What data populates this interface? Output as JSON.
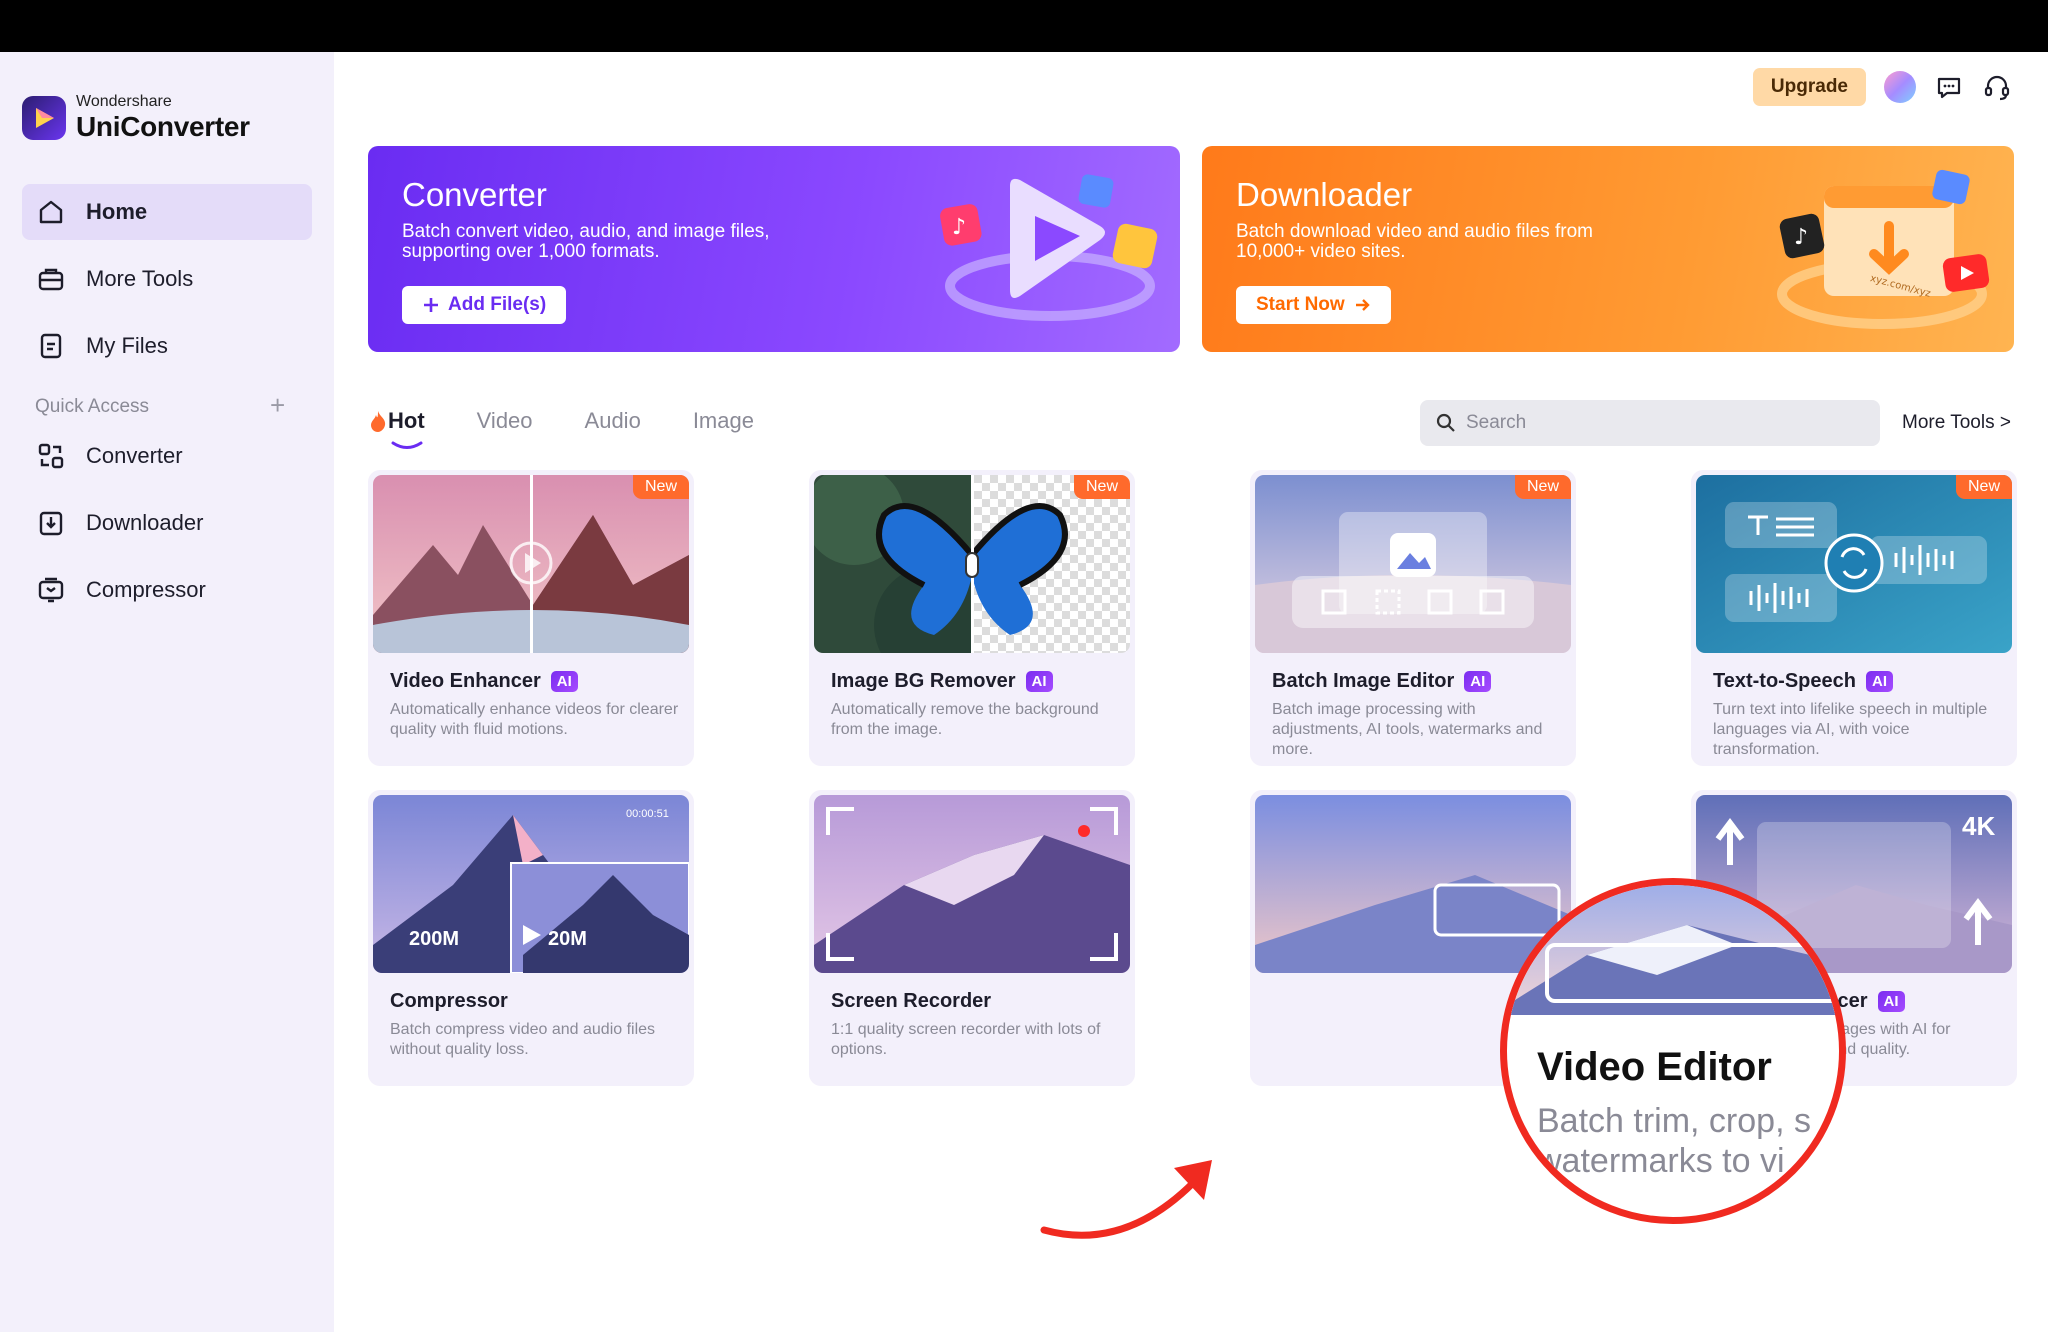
{
  "brand": {
    "small": "Wondershare",
    "big": "UniConverter"
  },
  "sidebar": {
    "items": [
      {
        "label": "Home"
      },
      {
        "label": "More Tools"
      },
      {
        "label": "My Files"
      }
    ],
    "quick_access_label": "Quick Access",
    "quick_access_plus": "+",
    "quick_items": [
      {
        "label": "Converter"
      },
      {
        "label": "Downloader"
      },
      {
        "label": "Compressor"
      }
    ]
  },
  "header": {
    "upgrade_label": "Upgrade"
  },
  "banners": {
    "converter": {
      "title": "Converter",
      "desc": "Batch convert video, audio, and image files, supporting over 1,000 formats.",
      "button": "Add File(s)"
    },
    "downloader": {
      "title": "Downloader",
      "desc": "Batch download video and audio files from 10,000+ video sites.",
      "button": "Start Now",
      "art_text": "xyz.com/xyz"
    }
  },
  "tabs": [
    {
      "label": "Hot"
    },
    {
      "label": "Video"
    },
    {
      "label": "Audio"
    },
    {
      "label": "Image"
    }
  ],
  "search": {
    "placeholder": "Search"
  },
  "more_tools_link": "More Tools >",
  "cards": [
    {
      "title": "Video Enhancer",
      "ai": "AI",
      "new": "New",
      "desc": "Automatically enhance videos for clearer quality with fluid motions."
    },
    {
      "title": "Image BG Remover",
      "ai": "AI",
      "new": "New",
      "desc": "Automatically remove the background from the image."
    },
    {
      "title": "Batch Image Editor",
      "ai": "AI",
      "new": "New",
      "desc": "Batch image processing with adjustments, AI tools, watermarks and more."
    },
    {
      "title": "Text-to-Speech",
      "ai": "AI",
      "new": "New",
      "desc": "Turn text into lifelike speech in multiple languages via AI, with voice transformation."
    },
    {
      "title": "Compressor",
      "desc": "Batch compress video and audio files without quality loss.",
      "timestamp": "00:00:51",
      "size_from": "200M",
      "size_to": "20M"
    },
    {
      "title": "Screen Recorder",
      "desc": "1:1 quality screen recorder with lots of options."
    },
    {
      "title": "Video Editor",
      "desc_visible": "d"
    },
    {
      "title": "Image Enhancer",
      "ai": "AI",
      "desc": "Batch enhance images with AI for improved clarity and quality.",
      "badge": "4K"
    }
  ],
  "magnifier": {
    "title": "Video Editor",
    "desc_line1": "Batch trim, crop, s",
    "desc_line2": "watermarks to vi"
  },
  "colors": {
    "accent": "#6a2cf2",
    "downloader": "#ff8a1f",
    "new_badge": "#ff6a2c",
    "highlight": "#f02a20",
    "sidebar_bg": "#f3f0fb"
  },
  "icons": {
    "home": "home-icon",
    "more_tools": "toolbox-icon",
    "my_files": "file-icon",
    "converter": "converter-icon",
    "downloader": "download-icon",
    "compressor": "compressor-icon",
    "search": "search-icon",
    "chat": "chat-icon",
    "headset": "headset-icon"
  }
}
